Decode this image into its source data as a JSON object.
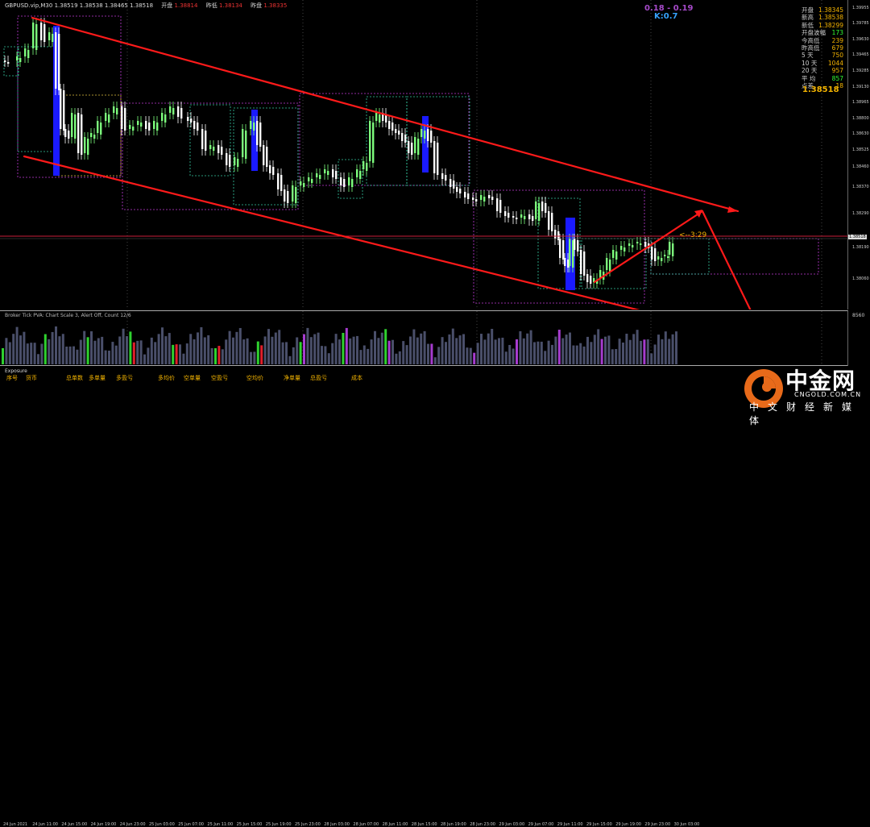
{
  "header": {
    "symbol": "GBPUSD.vip,M30",
    "quote": "1.38519 1.38538 1.38465 1.38518",
    "open_label": "开盘",
    "open_value": "1.38814",
    "low_label": "昨低",
    "low_value": "1.38134",
    "close_label": "昨盘",
    "close_value": "1.38335"
  },
  "kd": {
    "a": "0.18 - 0.19",
    "b": "K:0.7"
  },
  "stats": [
    {
      "label": "开盘",
      "value": "1.38345",
      "color": "#f4b400"
    },
    {
      "label": "新高",
      "value": "1.38538",
      "color": "#f4b400"
    },
    {
      "label": "新低",
      "value": "1.38299",
      "color": "#f4b400"
    },
    {
      "label": "开盘波幅",
      "value": "173",
      "color": "#33ff33"
    },
    {
      "label": "今高低",
      "value": "239",
      "color": "#f4b400"
    },
    {
      "label": "昨高低",
      "value": "679",
      "color": "#f4b400"
    },
    {
      "label": "5 天",
      "value": "750",
      "color": "#f4b400"
    },
    {
      "label": "10 天",
      "value": "1044",
      "color": "#f4b400"
    },
    {
      "label": "20 天",
      "value": "957",
      "color": "#f4b400"
    },
    {
      "label": "平 均",
      "value": "857",
      "color": "#33ff33"
    },
    {
      "label": "点差",
      "value": "18",
      "color": "#f4b400"
    }
  ],
  "current_price": "1.38518",
  "countdown": "<--3:29",
  "price_axis": [
    "1.39955",
    "1.39785",
    "1.39630",
    "1.39465",
    "1.39285",
    "1.39130",
    "1.38965",
    "1.38800",
    "1.38630",
    "1.38525",
    "1.38460",
    "1.38370",
    "1.38290",
    "1.38190",
    "1.38060"
  ],
  "current_price_tag": "1.38518",
  "indicator_label": "Broker Tick PVA:  Chart Scale  3,  Alert Off,  Count  12/6",
  "volume_axis": "8560",
  "exposure": {
    "title": "Exposure",
    "labels": [
      "序号",
      "货币",
      "总单数",
      "多单量",
      "多盈亏",
      "多均价",
      "空单量",
      "空盈亏",
      "空均价",
      "净单量",
      "总盈亏",
      "成本"
    ]
  },
  "time_axis": [
    "24 Jun 2021",
    "24 Jun 11:00",
    "24 Jun 15:00",
    "24 Jun 19:00",
    "24 Jun 23:00",
    "25 Jun 03:00",
    "25 Jun 07:00",
    "25 Jun 11:00",
    "25 Jun 15:00",
    "25 Jun 19:00",
    "25 Jun 23:00",
    "28 Jun 03:00",
    "28 Jun 07:00",
    "28 Jun 11:00",
    "28 Jun 15:00",
    "28 Jun 19:00",
    "28 Jun 23:00",
    "29 Jun 03:00",
    "29 Jun 07:00",
    "29 Jun 11:00",
    "29 Jun 15:00",
    "29 Jun 19:00",
    "29 Jun 23:00",
    "30 Jun 03:00"
  ],
  "logo": {
    "name": "中金网",
    "url": "CNGOLD.COM.CN",
    "tagline": "中文财经新媒体"
  },
  "colors": {
    "bull": "#7dff7d",
    "bear": "#ffffff",
    "trendline": "#ff1a1a",
    "block": "#1a1aff",
    "accent": "#f4b400"
  }
}
